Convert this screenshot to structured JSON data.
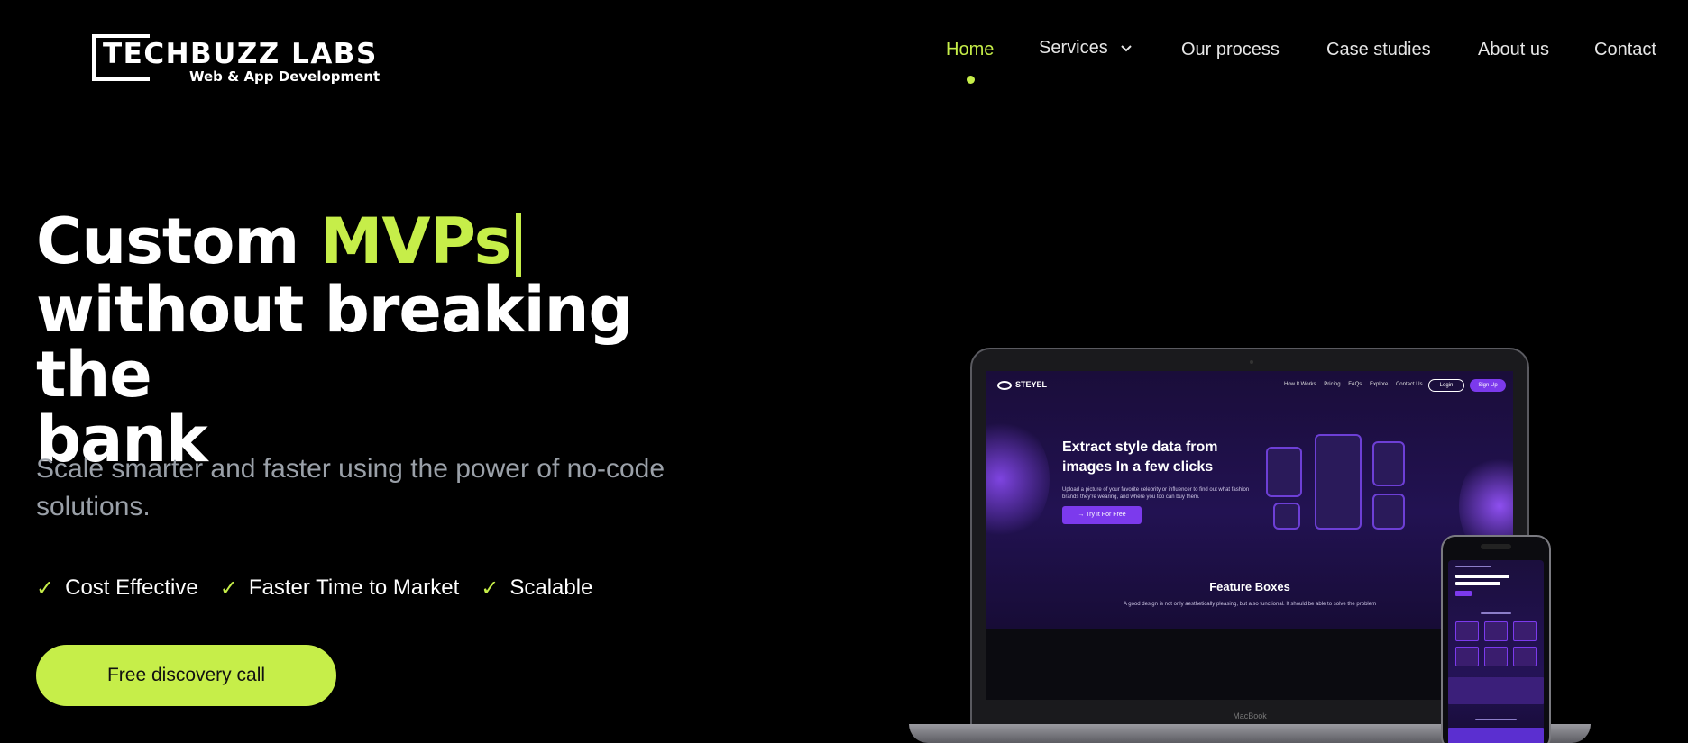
{
  "brand": {
    "title": "TECHBUZZ LABS",
    "subtitle": "Web & App Development"
  },
  "nav": {
    "items": [
      {
        "label": "Home",
        "active": true
      },
      {
        "label": "Services",
        "has_dropdown": true
      },
      {
        "label": "Our process"
      },
      {
        "label": "Case studies"
      },
      {
        "label": "About us"
      },
      {
        "label": "Contact"
      }
    ]
  },
  "hero": {
    "title_prefix": "Custom ",
    "title_accent": "MVPs",
    "title_line2": "without breaking the",
    "title_line3": "bank",
    "subtitle": "Scale smarter and faster using the power of no-code solutions.",
    "features": [
      "Cost Effective",
      "Faster Time to Market",
      "Scalable"
    ],
    "cta_label": "Free discovery call"
  },
  "mockup": {
    "logo": "STEYEL",
    "nav": [
      "How It Works",
      "Pricing",
      "FAQs",
      "Explore",
      "Contact Us"
    ],
    "login": "Login",
    "signup": "Sign Up",
    "headline": "Extract style data from images In a few clicks",
    "body": "Upload a picture of your favorite celebrity or influencer to find out what fashion brands they're wearing, and where you too can buy them.",
    "button": "→ Try It For Free",
    "section_title": "Feature Boxes",
    "section_body": "A good design is not only aesthetically pleasing, but also functional. It should be able to solve the problem",
    "device_label": "MacBook"
  },
  "colors": {
    "accent": "#c6ee49",
    "background": "#000000",
    "muted_text": "#9aa0a8",
    "mockup_purple": "#7c3aed"
  }
}
